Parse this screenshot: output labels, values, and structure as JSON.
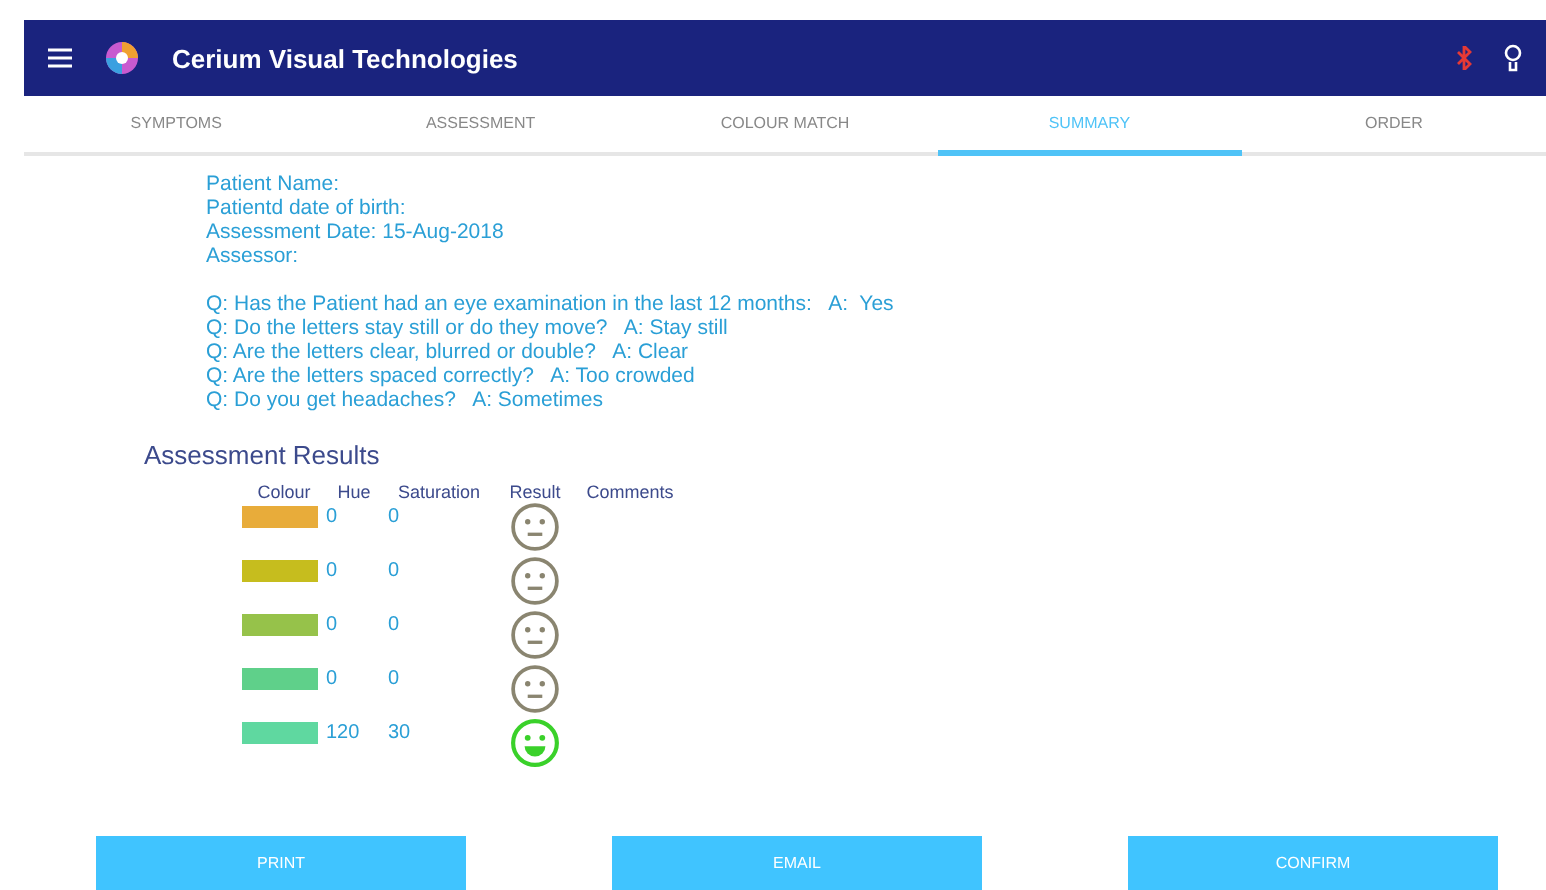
{
  "app_bar": {
    "title": "Cerium Visual Technologies"
  },
  "tabs": [
    {
      "label": "SYMPTOMS",
      "selected": false
    },
    {
      "label": "ASSESSMENT",
      "selected": false
    },
    {
      "label": "COLOUR MATCH",
      "selected": false
    },
    {
      "label": "SUMMARY",
      "selected": true
    },
    {
      "label": "ORDER",
      "selected": false
    }
  ],
  "patient_info": [
    "Patient Name:",
    "Patientd date of birth:",
    "Assessment Date: 15-Aug-2018",
    "Assessor:"
  ],
  "questions": [
    "Q: Has the Patient had an eye examination in the last 12 months:   A:  Yes",
    "Q: Do the letters stay still or do they move?   A: Stay still",
    "Q: Are the letters clear, blurred or double?   A: Clear",
    "Q: Are the letters spaced correctly?   A: Too crowded",
    "Q: Do you get headaches?   A: Sometimes"
  ],
  "results": {
    "title": "Assessment Results",
    "columns": [
      "Colour",
      "Hue",
      "Saturation",
      "Result",
      "Comments"
    ],
    "rows": [
      {
        "color": "#e8ac3a",
        "hue": "0",
        "saturation": "0",
        "kind": "neutral"
      },
      {
        "color": "#c6bd1e",
        "hue": "0",
        "saturation": "0",
        "kind": "neutral"
      },
      {
        "color": "#96c24a",
        "hue": "0",
        "saturation": "0",
        "kind": "neutral"
      },
      {
        "color": "#5fd08a",
        "hue": "0",
        "saturation": "0",
        "kind": "neutral"
      },
      {
        "color": "#5fd8a0",
        "hue": "120",
        "saturation": "30",
        "kind": "happy"
      }
    ]
  },
  "buttons": [
    "PRINT",
    "EMAIL",
    "CONFIRM"
  ]
}
